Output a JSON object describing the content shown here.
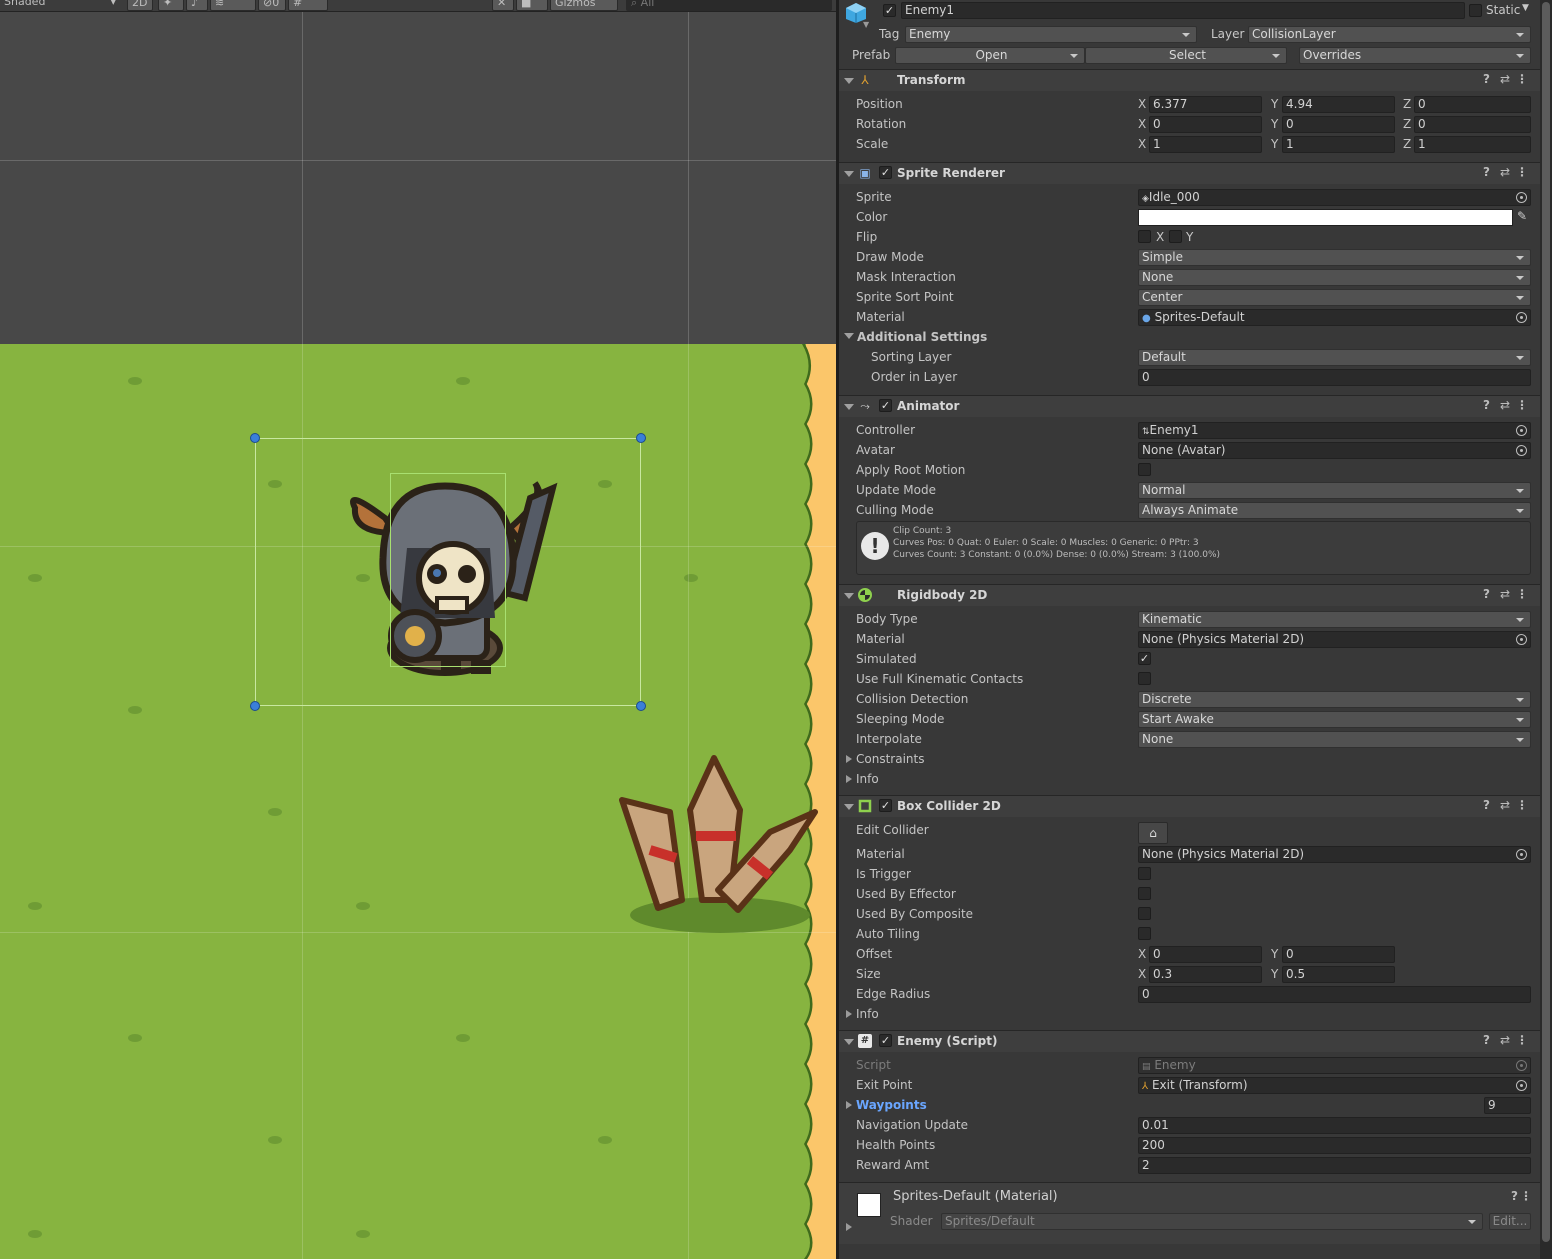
{
  "toolbar": {
    "shading_mode": "Shaded",
    "mode_2d": "2D",
    "hidden_count": "0",
    "gizmos": "Gizmos",
    "search_placeholder": "All"
  },
  "object": {
    "name": "Enemy1",
    "static_label": "Static",
    "tag_label": "Tag",
    "tag_value": "Enemy",
    "layer_label": "Layer",
    "layer_value": "CollisionLayer",
    "prefab_label": "Prefab",
    "prefab_open": "Open",
    "prefab_select": "Select",
    "prefab_overrides": "Overrides"
  },
  "transform": {
    "title": "Transform",
    "rows": [
      {
        "label": "Position",
        "x": "6.377",
        "y": "4.94",
        "z": "0"
      },
      {
        "label": "Rotation",
        "x": "0",
        "y": "0",
        "z": "0"
      },
      {
        "label": "Scale",
        "x": "1",
        "y": "1",
        "z": "1"
      }
    ]
  },
  "sprite_renderer": {
    "title": "Sprite Renderer",
    "sprite_label": "Sprite",
    "sprite": "Idle_000",
    "color_label": "Color",
    "flip_label": "Flip",
    "flip_x": "X",
    "flip_y": "Y",
    "draw_mode_label": "Draw Mode",
    "draw_mode": "Simple",
    "mask_label": "Mask Interaction",
    "mask": "None",
    "sort_point_label": "Sprite Sort Point",
    "sort_point": "Center",
    "material_label": "Material",
    "material": "Sprites-Default",
    "additional": "Additional Settings",
    "sorting_layer_label": "Sorting Layer",
    "sorting_layer": "Default",
    "order_label": "Order in Layer",
    "order": "0"
  },
  "animator": {
    "title": "Animator",
    "controller_label": "Controller",
    "controller": "Enemy1",
    "avatar_label": "Avatar",
    "avatar": "None (Avatar)",
    "root_motion_label": "Apply Root Motion",
    "update_label": "Update Mode",
    "update": "Normal",
    "culling_label": "Culling Mode",
    "culling": "Always Animate",
    "info1": "Clip Count: 3",
    "info2": "Curves Pos: 0 Quat: 0 Euler: 0 Scale: 0 Muscles: 0 Generic: 0 PPtr: 3",
    "info3": "Curves Count: 3 Constant: 0 (0.0%) Dense: 0 (0.0%) Stream: 3 (100.0%)"
  },
  "rigidbody": {
    "title": "Rigidbody 2D",
    "body_type_label": "Body Type",
    "body_type": "Kinematic",
    "material_label": "Material",
    "material": "None (Physics Material 2D)",
    "simulated_label": "Simulated",
    "full_kin_label": "Use Full Kinematic Contacts",
    "collision_label": "Collision Detection",
    "collision": "Discrete",
    "sleeping_label": "Sleeping Mode",
    "sleeping": "Start Awake",
    "interpolate_label": "Interpolate",
    "interpolate": "None",
    "constraints_label": "Constraints",
    "info_label": "Info"
  },
  "box_collider": {
    "title": "Box Collider 2D",
    "edit_label": "Edit Collider",
    "material_label": "Material",
    "material": "None (Physics Material 2D)",
    "trigger_label": "Is Trigger",
    "effector_label": "Used By Effector",
    "composite_label": "Used By Composite",
    "tiling_label": "Auto Tiling",
    "offset_label": "Offset",
    "offset_x": "0",
    "offset_y": "0",
    "size_label": "Size",
    "size_x": "0.3",
    "size_y": "0.5",
    "edge_label": "Edge Radius",
    "edge": "0",
    "info_label": "Info"
  },
  "enemy_script": {
    "title": "Enemy (Script)",
    "script_label": "Script",
    "script": "Enemy",
    "exit_label": "Exit Point",
    "exit": "Exit (Transform)",
    "waypoints_label": "Waypoints",
    "waypoints_count": "9",
    "nav_label": "Navigation Update",
    "nav": "0.01",
    "hp_label": "Health Points",
    "hp": "200",
    "reward_label": "Reward Amt",
    "reward": "2"
  },
  "material_panel": {
    "name": "Sprites-Default (Material)",
    "shader_label": "Shader",
    "shader": "Sprites/Default",
    "edit": "Edit..."
  },
  "axes": {
    "x": "X",
    "y": "Y",
    "z": "Z"
  },
  "colors": {
    "grass": "#87b440",
    "sand": "#fbc66a",
    "selection": "#c8e8a0",
    "handle": "#3a7fd8"
  }
}
